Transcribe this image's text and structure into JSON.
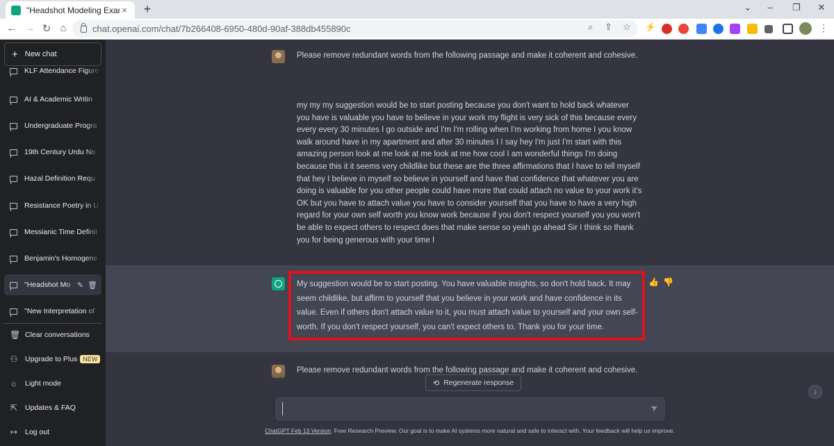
{
  "browser": {
    "tab_title": "\"Headshot Modeling Example\"",
    "tab_close": "×",
    "new_tab": "+",
    "url": "chat.openai.com/chat/7b266408-6950-480d-90af-388db455890c"
  },
  "sidebar": {
    "new_chat": "New chat",
    "chats": [
      {
        "label": "KLF Attendance Figure"
      },
      {
        "label": "AI & Academic Writin"
      },
      {
        "label": "Undergraduate Progra"
      },
      {
        "label": "19th Century Urdu No"
      },
      {
        "label": "Hazal Definition Requ"
      },
      {
        "label": "Resistance Poetry in U"
      },
      {
        "label": "Messianic Time Definit"
      },
      {
        "label": "Benjamin's Homogene"
      },
      {
        "label": "\"Headshot Mo"
      },
      {
        "label": "\"New Interpretation of"
      }
    ],
    "options": {
      "clear": "Clear conversations",
      "upgrade": "Upgrade to Plus",
      "upgrade_badge": "NEW",
      "light_mode": "Light mode",
      "updates": "Updates & FAQ",
      "logout": "Log out"
    }
  },
  "conversation": {
    "user_prompt": "Please remove redundant words from the following passage and make it coherent and cohesive.",
    "user_passage": "my my my suggestion would be to start posting because you don't want to hold back whatever you have is valuable you have to believe in your work my flight is very sick of this because every every every 30 minutes I go outside and I'm I'm rolling when I'm working from home I you know walk around have in my apartment and after 30 minutes I I say hey I'm just I'm start with this amazing person look at me look at me look at me how cool I am wonderful things I'm doing because this it it seems very childlike but these are the three affirmations that I have to tell myself that hey I believe in myself so believe in yourself and have that confidence that whatever you are doing is valuable for you other people could have more that could attach no value to your work it's OK but you have to attach value you have to consider yourself that you have to have a very high regard for your own self worth you know work because if you don't respect yourself you you won't be able to expect others to respect does that make sense so yeah go ahead Sir I think so thank you for being generous with your time I",
    "bot_response": "My suggestion would be to start posting. You have valuable insights, so don't hold back. It may seem childlike, but affirm to yourself that you believe in your work and have confidence in its value. Even if others don't attach value to it, you must attach value to yourself and your own self-worth. If you don't respect yourself, you can't expect others to. Thank you for your time.",
    "next_user_prompt": "Please remove redundant words from the following passage and make it coherent and cohesive."
  },
  "controls": {
    "regenerate": "Regenerate response",
    "input_placeholder": ""
  },
  "footer": {
    "version_link": "ChatGPT Feb 13 Version",
    "text": ". Free Research Preview. Our goal is to make AI systems more natural and safe to interact with. Your feedback will help us improve."
  },
  "colors": {
    "sidebar_bg": "#202123",
    "main_bg": "#343541",
    "bot_bg": "#444654",
    "highlight_box": "#e0121e",
    "brand": "#10a37f"
  }
}
